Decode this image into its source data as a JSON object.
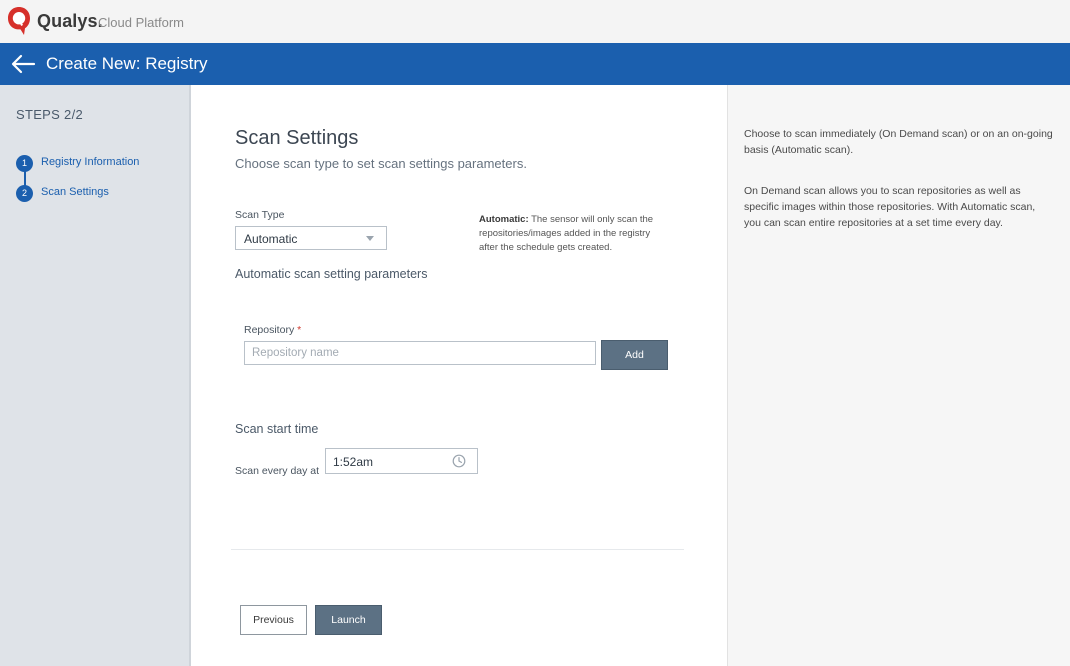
{
  "brand": {
    "name": "Qualys.",
    "product": "Cloud Platform"
  },
  "header": {
    "title": "Create New: Registry",
    "back_icon": "arrow-left-icon"
  },
  "sidebar": {
    "steps_label": "STEPS 2/2",
    "steps": [
      {
        "number": "1",
        "label": "Registry Information"
      },
      {
        "number": "2",
        "label": "Scan Settings"
      }
    ]
  },
  "main": {
    "title": "Scan Settings",
    "subtitle": "Choose scan type to set scan settings parameters.",
    "scan_type": {
      "label": "Scan Type",
      "selected": "Automatic",
      "note_term": "Automatic:",
      "note_text": " The sensor will only scan the repositories/images added in the registry after the schedule gets created."
    },
    "auto_params_title": "Automatic scan setting parameters",
    "repository": {
      "label": "Repository",
      "required_mark": "*",
      "placeholder": "Repository name",
      "value": "",
      "add_label": "Add"
    },
    "scan_time": {
      "title": "Scan start time",
      "label": "Scan every day at",
      "value": "1:52am",
      "icon": "clock-icon"
    },
    "previous_label": "Previous",
    "launch_label": "Launch"
  },
  "help": {
    "paragraph1": "Choose to scan immediately (On Demand scan) or on an on-going basis (Automatic scan).",
    "paragraph2": "On Demand scan allows you to scan repositories as well as specific images within those repositories. With Automatic scan, you can scan entire repositories at a set time every day."
  },
  "colors": {
    "brand_red": "#d6302a",
    "header_blue": "#1b5fae",
    "sidebar_bg": "#dfe3e8",
    "primary_button": "#5c7184"
  }
}
